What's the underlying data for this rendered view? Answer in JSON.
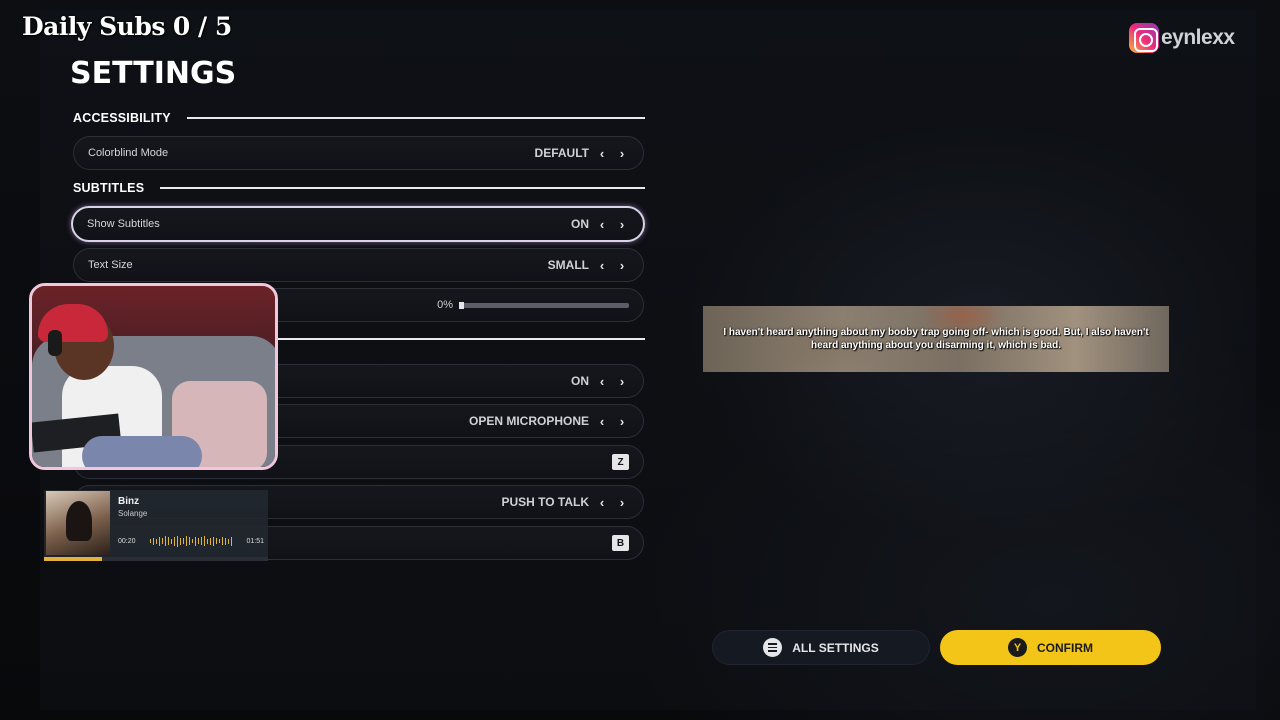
{
  "overlay": {
    "daily_subs_label": "Daily Subs",
    "daily_subs_count": "0 / 5",
    "instagram_handle": "eynlexx"
  },
  "settings": {
    "title": "SETTINGS",
    "sections": {
      "accessibility": "ACCESSIBILITY",
      "subtitles": "SUBTITLES"
    },
    "rows": {
      "colorblind": {
        "label": "Colorblind Mode",
        "value": "DEFAULT"
      },
      "show_subtitles": {
        "label": "Show Subtitles",
        "value": "ON"
      },
      "text_size": {
        "label": "Text Size",
        "value": "SMALL"
      },
      "background_opacity": {
        "value": "0%",
        "level": 0.0
      },
      "row_on": {
        "value": "ON"
      },
      "open_mic": {
        "value": "OPEN MICROPHONE"
      },
      "key_z": {
        "value": "Z"
      },
      "push_to_talk": {
        "value": "PUSH TO TALK"
      },
      "key_b": {
        "value": "B"
      }
    }
  },
  "subtitle_preview": {
    "text": "I haven't heard anything about my booby trap going off- which is good. But, I also haven't heard anything about you disarming it, which is bad."
  },
  "buttons": {
    "all_settings": "ALL SETTINGS",
    "confirm": "CONFIRM",
    "confirm_key": "Y"
  },
  "now_playing": {
    "title": "Binz",
    "artist": "Solange",
    "elapsed": "00:20",
    "duration": "01:51",
    "progress": 0.26
  },
  "colors": {
    "accent_confirm": "#f2c518",
    "cam_border": "#f0c7dd",
    "active_row_glow": "#d9d4e6",
    "player_accent": "#e2b23c"
  }
}
